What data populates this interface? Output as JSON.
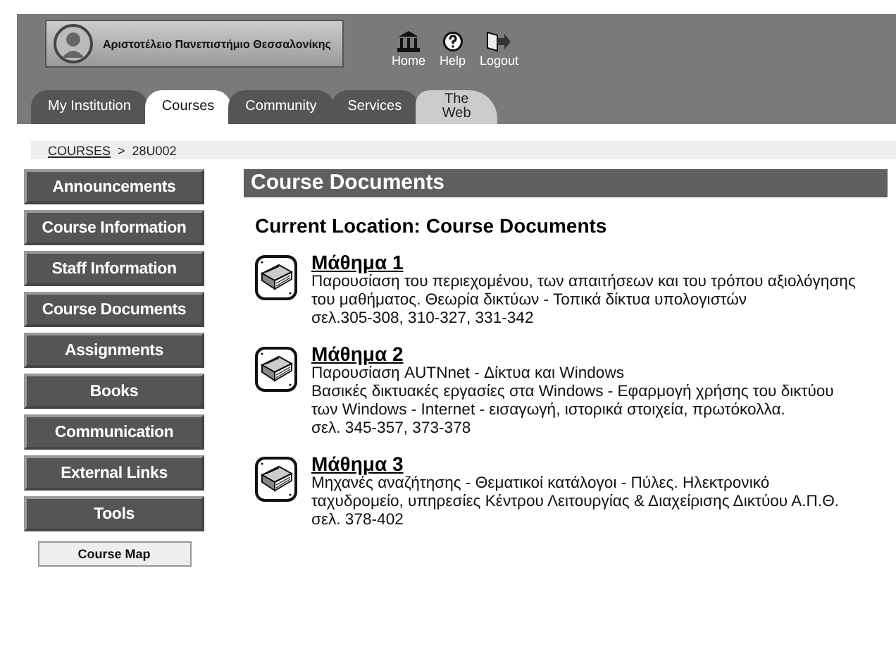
{
  "header": {
    "logo_text": "Αριστοτέλειο Πανεπιστήμιο Θεσσαλονίκης",
    "nav": [
      {
        "kind": "home",
        "label": "Home"
      },
      {
        "kind": "help",
        "label": "Help"
      },
      {
        "kind": "logout",
        "label": "Logout"
      }
    ],
    "tabs": [
      {
        "label": "My Institution",
        "selected": false,
        "kind": "standard"
      },
      {
        "label": "Courses",
        "selected": true,
        "kind": "standard"
      },
      {
        "label": "Community",
        "selected": false,
        "kind": "standard"
      },
      {
        "label": "Services",
        "selected": false,
        "kind": "standard"
      },
      {
        "label": "The Web",
        "selected": false,
        "kind": "external"
      }
    ]
  },
  "breadcrumb": {
    "link": "COURSES",
    "separator": ">",
    "current": "28U002"
  },
  "sidebar": {
    "items": [
      {
        "label": "Announcements"
      },
      {
        "label": "Course Information"
      },
      {
        "label": "Staff Information"
      },
      {
        "label": "Course Documents"
      },
      {
        "label": "Assignments"
      },
      {
        "label": "Books"
      },
      {
        "label": "Communication"
      },
      {
        "label": "External Links"
      },
      {
        "label": "Tools"
      }
    ],
    "course_map": "Course Map"
  },
  "content": {
    "title": "Course Documents",
    "location": "Current Location: Course Documents",
    "items": [
      {
        "title": "Μάθημα 1",
        "lines": [
          "Παρουσίαση του περιεχομένου, των απαιτήσεων και του τρόπου αξιολόγησης του μαθήματος. Θεωρία δικτύων - Τοπικά δίκτυα υπολογιστών",
          "σελ.305-308, 310-327, 331-342"
        ]
      },
      {
        "title": "Μάθημα 2",
        "lines": [
          "Παρουσίαση AUTNnet - Δίκτυα και Windows",
          "Βασικές δικτυακές εργασίες στα Windows - Εφαρμογή χρήσης του δικτύου των Windows - Internet - εισαγωγή, ιστορικά στοιχεία, πρωτόκολλα.",
          "σελ. 345-357, 373-378"
        ]
      },
      {
        "title": "Μάθημα 3",
        "lines": [
          "Μηχανές αναζήτησης - Θεματικοί κατάλογοι - Πύλες. Ηλεκτρονικό ταχυδρομείο, υπηρεσίες Κέντρου Λειτουργίας & Διαχείρισης Δικτύου Α.Π.Θ.",
          "σελ. 378-402"
        ]
      }
    ]
  }
}
